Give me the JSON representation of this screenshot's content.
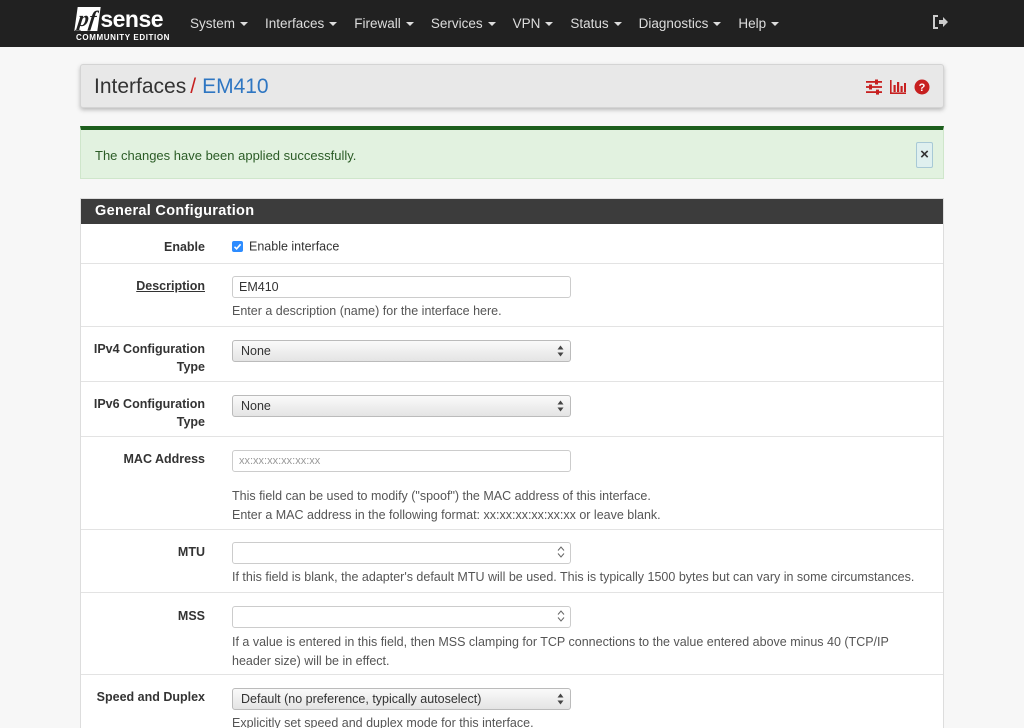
{
  "brand": {
    "logo_pf": "pf",
    "logo_sense": "sense",
    "edition": "COMMUNITY EDITION"
  },
  "nav": {
    "items": [
      "System",
      "Interfaces",
      "Firewall",
      "Services",
      "VPN",
      "Status",
      "Diagnostics",
      "Help"
    ],
    "logout_icon": "sign-out-icon"
  },
  "header": {
    "section": "Interfaces",
    "separator": "/",
    "page": "EM410",
    "icons": [
      "sliders-icon",
      "bar-chart-icon",
      "question-circle-icon"
    ]
  },
  "alert": {
    "message": "The changes have been applied successfully.",
    "close": "×"
  },
  "panel": {
    "title": "General Configuration",
    "enable": {
      "label": "Enable",
      "checkbox_label": "Enable interface",
      "checked": true
    },
    "description": {
      "label": "Description",
      "value": "EM410",
      "help": "Enter a description (name) for the interface here."
    },
    "ipv4": {
      "label_line1": "IPv4 Configuration",
      "label_line2": "Type",
      "value": "None"
    },
    "ipv6": {
      "label_line1": "IPv6 Configuration",
      "label_line2": "Type",
      "value": "None"
    },
    "mac": {
      "label": "MAC Address",
      "placeholder": "xx:xx:xx:xx:xx:xx",
      "help_line1": "This field can be used to modify (\"spoof\") the MAC address of this interface.",
      "help_line2": "Enter a MAC address in the following format: xx:xx:xx:xx:xx:xx or leave blank."
    },
    "mtu": {
      "label": "MTU",
      "value": "",
      "help": "If this field is blank, the adapter's default MTU will be used. This is typically 1500 bytes but can vary in some circumstances."
    },
    "mss": {
      "label": "MSS",
      "value": "",
      "help_line1": "If a value is entered in this field, then MSS clamping for TCP connections to the value entered above minus 40 (TCP/IP",
      "help_line2": "header size) will be in effect."
    },
    "speed": {
      "label": "Speed and Duplex",
      "value": "Default (no preference, typically autoselect)",
      "help": "Explicitly set speed and duplex mode for this interface."
    }
  },
  "colors": {
    "navbar": "#212121",
    "accent_red": "#c72020",
    "link_blue": "#2e76c2",
    "alert_bg": "#e2f2e0",
    "alert_border": "#1d5e1d",
    "panel_heading": "#3c3c3c"
  }
}
